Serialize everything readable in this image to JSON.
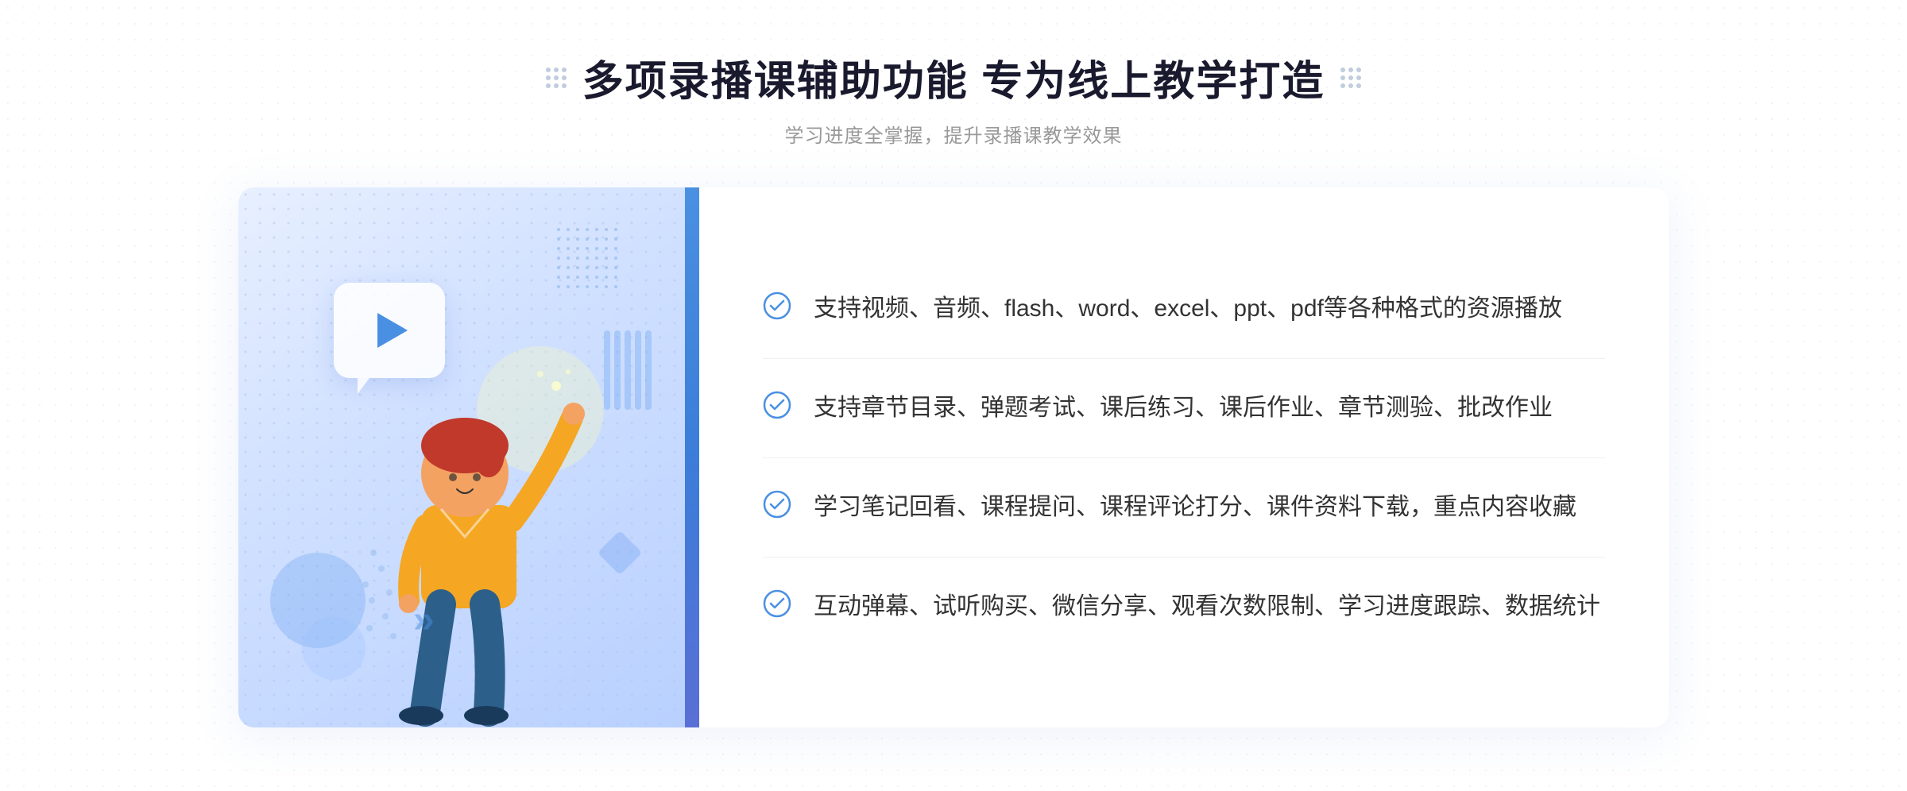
{
  "header": {
    "title": "多项录播课辅助功能 专为线上教学打造",
    "subtitle": "学习进度全掌握，提升录播课教学效果"
  },
  "features": [
    {
      "id": "feature-1",
      "text": "支持视频、音频、flash、word、excel、ppt、pdf等各种格式的资源播放"
    },
    {
      "id": "feature-2",
      "text": "支持章节目录、弹题考试、课后练习、课后作业、章节测验、批改作业"
    },
    {
      "id": "feature-3",
      "text": "学习笔记回看、课程提问、课程评论打分、课件资料下载，重点内容收藏"
    },
    {
      "id": "feature-4",
      "text": "互动弹幕、试听购买、微信分享、观看次数限制、学习进度跟踪、数据统计"
    }
  ],
  "decoration": {
    "chevron_symbol": "»",
    "play_label": "play-button"
  }
}
